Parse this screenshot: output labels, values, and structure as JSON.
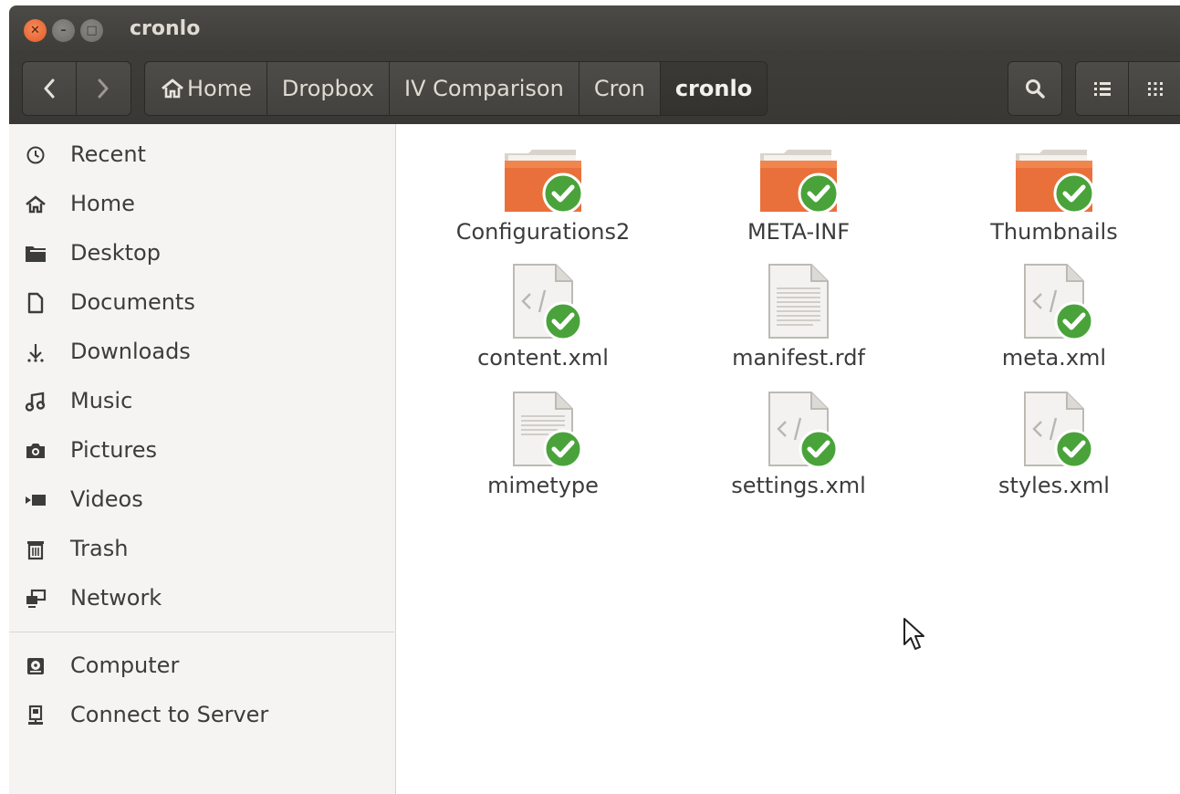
{
  "window": {
    "title": "cronlo"
  },
  "breadcrumbs": [
    "Home",
    "Dropbox",
    "IV Comparison",
    "Cron",
    "cronlo"
  ],
  "sidebar": {
    "places": [
      {
        "label": "Recent",
        "icon": "clock-icon"
      },
      {
        "label": "Home",
        "icon": "home-icon"
      },
      {
        "label": "Desktop",
        "icon": "desktop-folder-icon"
      },
      {
        "label": "Documents",
        "icon": "document-icon"
      },
      {
        "label": "Downloads",
        "icon": "download-icon"
      },
      {
        "label": "Music",
        "icon": "music-icon"
      },
      {
        "label": "Pictures",
        "icon": "camera-icon"
      },
      {
        "label": "Videos",
        "icon": "video-icon"
      },
      {
        "label": "Trash",
        "icon": "trash-icon"
      },
      {
        "label": "Network",
        "icon": "network-icon"
      }
    ],
    "devices": [
      {
        "label": "Computer",
        "icon": "harddisk-icon"
      },
      {
        "label": "Connect to Server",
        "icon": "server-icon"
      }
    ]
  },
  "files": [
    {
      "name": "Configurations2",
      "type": "folder",
      "synced": true
    },
    {
      "name": "META-INF",
      "type": "folder",
      "synced": true
    },
    {
      "name": "Thumbnails",
      "type": "folder",
      "synced": true
    },
    {
      "name": "content.xml",
      "type": "xml",
      "synced": true
    },
    {
      "name": "manifest.rdf",
      "type": "text",
      "synced": false
    },
    {
      "name": "meta.xml",
      "type": "xml",
      "synced": true
    },
    {
      "name": "mimetype",
      "type": "text",
      "synced": true
    },
    {
      "name": "settings.xml",
      "type": "xml",
      "synced": true
    },
    {
      "name": "styles.xml",
      "type": "xml",
      "synced": true
    }
  ],
  "colors": {
    "folder_orange": "#e9703a",
    "sync_green": "#4aa33a",
    "toolbar_dark": "#3c3b37"
  }
}
